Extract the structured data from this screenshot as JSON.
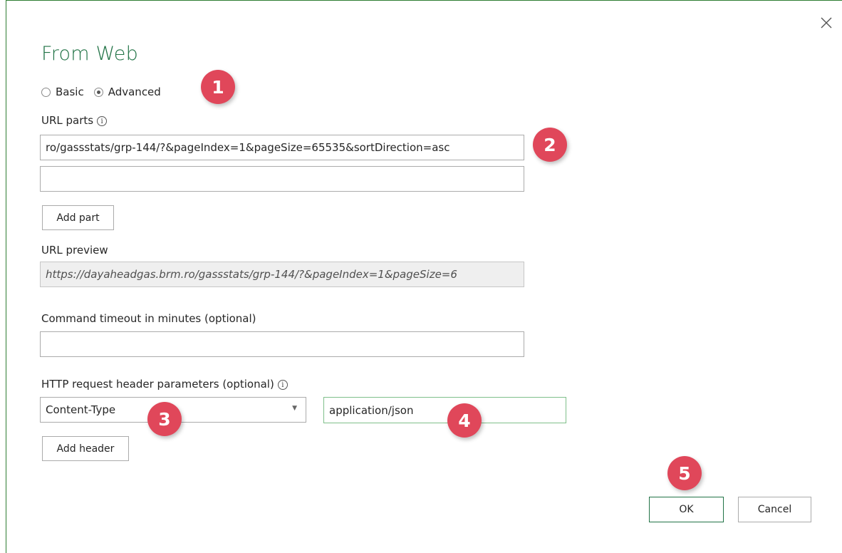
{
  "dialog": {
    "title": "From Web",
    "mode_options": [
      {
        "label": "Basic",
        "selected": false
      },
      {
        "label": "Advanced",
        "selected": true
      }
    ],
    "url_parts_label": "URL parts",
    "url_parts": [
      "ro/gassstats/grp-144/?&pageIndex=1&pageSize=65535&sortDirection=asc",
      ""
    ],
    "add_part_label": "Add part",
    "url_preview_label": "URL preview",
    "url_preview_value": "https://dayaheadgas.brm.ro/gassstats/grp-144/?&pageIndex=1&pageSize=6",
    "timeout_label": "Command timeout in minutes (optional)",
    "timeout_value": "",
    "headers_label": "HTTP request header parameters (optional)",
    "header_name_selected": "Content-Type",
    "header_value": "application/json",
    "add_header_label": "Add header",
    "ok_label": "OK",
    "cancel_label": "Cancel"
  },
  "annotations": [
    "1",
    "2",
    "3",
    "4",
    "5"
  ],
  "colors": {
    "accent_green": "#217346",
    "badge_red": "#e0475a"
  },
  "icons": {
    "close": "close-icon",
    "info": "info-icon",
    "dropdown": "chevron-down-icon"
  }
}
